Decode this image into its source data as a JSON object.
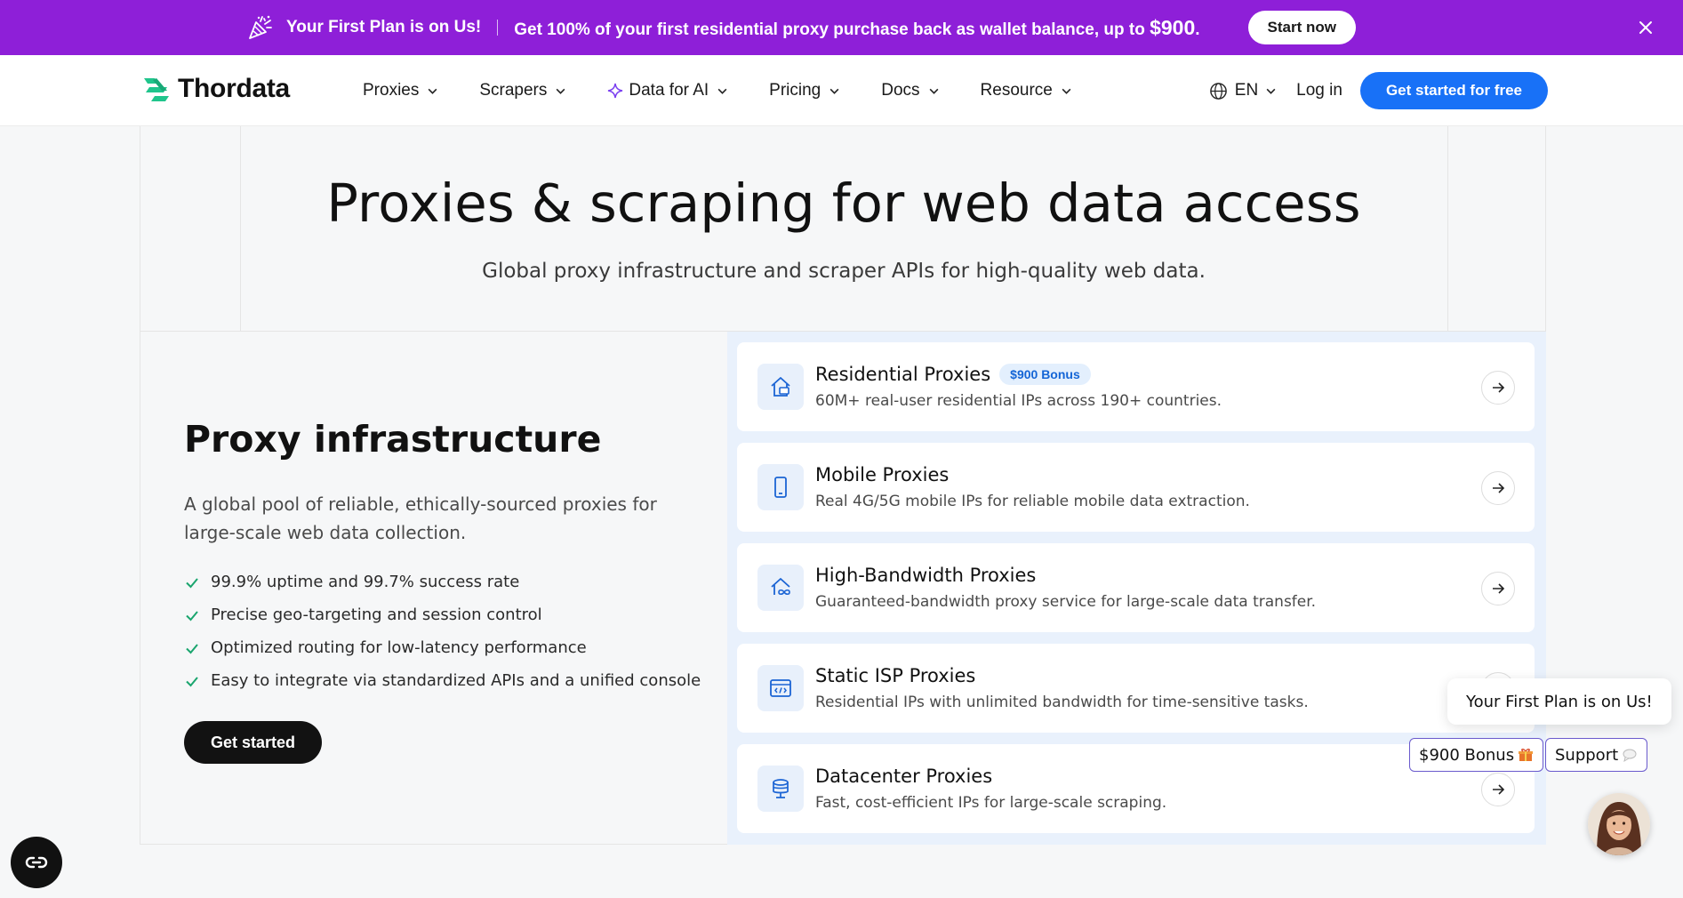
{
  "promo": {
    "icon": "party-popper-icon",
    "headline": "Your First Plan is on Us!",
    "text": "Get 100% of your first residential proxy purchase back as wallet balance, up to",
    "amount": "$900",
    "period": ".",
    "button": "Start now",
    "background": "#8e1fd8"
  },
  "nav": {
    "logo": "Thordata",
    "items": [
      {
        "label": "Proxies"
      },
      {
        "label": "Scrapers"
      },
      {
        "label": "Data for AI"
      },
      {
        "label": "Pricing"
      },
      {
        "label": "Docs"
      },
      {
        "label": "Resource"
      }
    ],
    "language": "EN",
    "login": "Log in",
    "cta": "Get started for free",
    "cta_color": "#1871f7"
  },
  "hero": {
    "title": "Proxies & scraping for web data access",
    "subtitle": "Global proxy infrastructure and scraper APIs for high-quality web data."
  },
  "section": {
    "title": "Proxy infrastructure",
    "description": "A global pool of reliable, ethically-sourced proxies for large-scale web data collection.",
    "features": [
      "99.9% uptime and 99.7% success rate",
      "Precise geo-targeting and session control",
      "Optimized routing for low-latency performance",
      "Easy to integrate via standardized APIs and a unified console"
    ],
    "button": "Get started"
  },
  "cards": [
    {
      "title": "Residential Proxies",
      "badge": "$900 Bonus",
      "description": "60M+ real-user residential IPs across 190+ countries.",
      "icon": "house-icon"
    },
    {
      "title": "Mobile Proxies",
      "badge": "",
      "description": "Real 4G/5G mobile IPs for reliable mobile data extraction.",
      "icon": "smartphone-icon"
    },
    {
      "title": "High-Bandwidth Proxies",
      "badge": "",
      "description": "Guaranteed-bandwidth proxy service for large-scale data transfer.",
      "icon": "infinity-house-icon"
    },
    {
      "title": "Static ISP Proxies",
      "badge": "",
      "description": "Residential IPs with unlimited bandwidth for time-sensitive tasks.",
      "icon": "code-window-icon"
    },
    {
      "title": "Datacenter Proxies",
      "badge": "",
      "description": "Fast, cost-efficient IPs for large-scale scraping.",
      "icon": "database-icon"
    }
  ],
  "widgets": {
    "bubble": "Your First Plan is on Us!",
    "bonus_chip": "$900 Bonus",
    "support_chip": "Support"
  }
}
